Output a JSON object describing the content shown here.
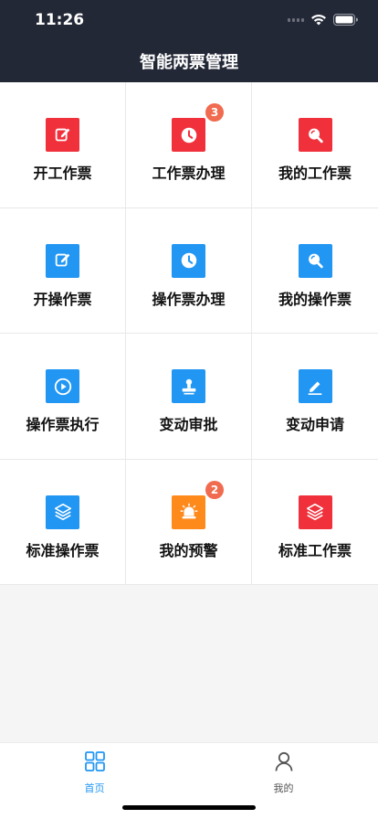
{
  "status": {
    "time": "11:26"
  },
  "header": {
    "title": "智能两票管理"
  },
  "colors": {
    "red": "#f0313c",
    "blue": "#2196f3",
    "orange": "#ff8a1c",
    "badge": "#f06b4f",
    "tab_active": "#2196f3",
    "tab_inactive": "#555555"
  },
  "grid": [
    {
      "label": "开工作票",
      "icon": "edit-icon",
      "color": "red"
    },
    {
      "label": "工作票办理",
      "icon": "clock-icon",
      "color": "red",
      "badge": "3"
    },
    {
      "label": "我的工作票",
      "icon": "search-icon",
      "color": "red"
    },
    {
      "label": "开操作票",
      "icon": "edit-icon",
      "color": "blue"
    },
    {
      "label": "操作票办理",
      "icon": "clock-icon",
      "color": "blue"
    },
    {
      "label": "我的操作票",
      "icon": "search-icon",
      "color": "blue"
    },
    {
      "label": "操作票执行",
      "icon": "play-icon",
      "color": "blue"
    },
    {
      "label": "变动审批",
      "icon": "stamp-icon",
      "color": "blue"
    },
    {
      "label": "变动申请",
      "icon": "pen-icon",
      "color": "blue"
    },
    {
      "label": "标准操作票",
      "icon": "layers-icon",
      "color": "blue"
    },
    {
      "label": "我的预警",
      "icon": "alarm-icon",
      "color": "orange",
      "badge": "2"
    },
    {
      "label": "标准工作票",
      "icon": "layers-icon",
      "color": "red"
    }
  ],
  "tabs": [
    {
      "label": "首页",
      "icon": "grid-icon",
      "active": true
    },
    {
      "label": "我的",
      "icon": "user-icon",
      "active": false
    }
  ]
}
